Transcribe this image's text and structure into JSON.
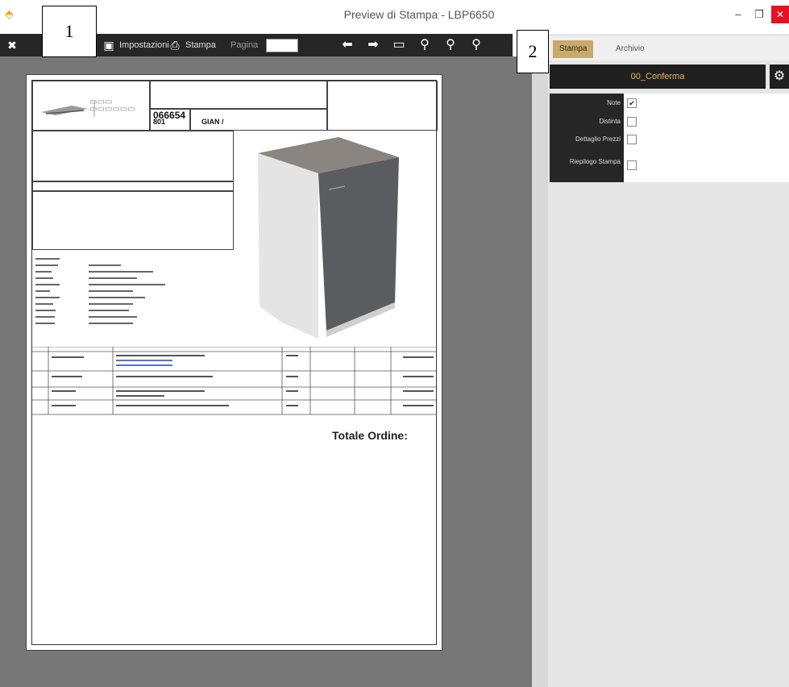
{
  "window": {
    "title": "Preview di Stampa - LBP6650",
    "minimize": "–",
    "restore": "❐",
    "close": "✕"
  },
  "toolbar": {
    "impostazioni_label": "Impostazioni",
    "stampa_label": "Stampa",
    "pagina_label": "Pagina"
  },
  "annotations": {
    "one": "1",
    "two": "2"
  },
  "document": {
    "order_number": "066654",
    "code": "801",
    "client": "GIAN /",
    "totale_label": "Totale Ordine:"
  },
  "panel": {
    "tabs": [
      "Stampa",
      "Archivio"
    ],
    "active_tab": 0,
    "config_label": "00_Conferma",
    "options": [
      {
        "label": "Note",
        "checked": true
      },
      {
        "label": "Distinta",
        "checked": false
      },
      {
        "label": "Dettaglio Prezzi",
        "checked": false
      },
      {
        "label": "Riepilogo Stampa",
        "checked": false
      }
    ]
  },
  "colors": {
    "accent_gold": "#e2b94f",
    "tab_active": "#c9a96e",
    "close_red": "#e81123"
  }
}
